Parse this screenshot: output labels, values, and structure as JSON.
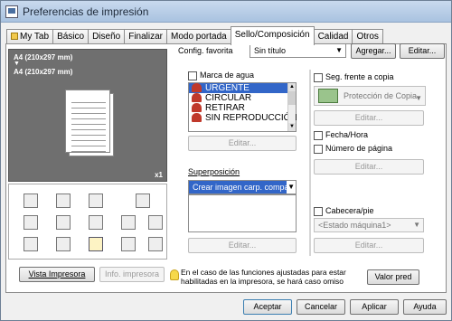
{
  "window": {
    "title": "Preferencias de impresión"
  },
  "tabs": [
    {
      "label": "My Tab"
    },
    {
      "label": "Básico"
    },
    {
      "label": "Diseño"
    },
    {
      "label": "Finalizar"
    },
    {
      "label": "Modo portada"
    },
    {
      "label": "Sello/Composición",
      "active": true
    },
    {
      "label": "Calidad"
    },
    {
      "label": "Otros"
    }
  ],
  "preview": {
    "line1": "A4 (210x297 mm)",
    "arrow": "▼",
    "line2": "A4 (210x297 mm)",
    "copies": "x1"
  },
  "left_buttons": {
    "printer_view": "Vista Impresora",
    "printer_info": "Info. impresora"
  },
  "favorite": {
    "label": "Config. favorita",
    "value": "Sin título",
    "add": "Agregar...",
    "edit": "Editar..."
  },
  "watermark": {
    "label": "Marca de agua",
    "items": [
      "URGENTE",
      "CIRCULAR",
      "RETIRAR",
      "SIN REPRODUCCIÓN"
    ],
    "selected": "URGENTE",
    "edit": "Editar..."
  },
  "overlay": {
    "label": "Superposición",
    "value": "Crear imagen carp. compart...",
    "edit": "Editar..."
  },
  "copy_security": {
    "label": "Seg. frente a copia",
    "value": "Protección de Copia",
    "edit": "Editar..."
  },
  "datetime": {
    "label": "Fecha/Hora"
  },
  "page_number": {
    "label": "Número de página",
    "edit": "Editar..."
  },
  "header_footer": {
    "label": "Cabecera/pie",
    "value": "<Estado máquina1>",
    "edit": "Editar..."
  },
  "note": {
    "text": "En el caso de las funciones ajustadas para estar habilitadas en la impresora, se hará caso omiso"
  },
  "default_button": "Valor pred",
  "footer": {
    "ok": "Aceptar",
    "cancel": "Cancelar",
    "apply": "Aplicar",
    "help": "Ayuda"
  },
  "colors": {
    "accent": "#3266c8",
    "selected_tab": "#ffffff",
    "title_bar": "#b8cde6"
  }
}
